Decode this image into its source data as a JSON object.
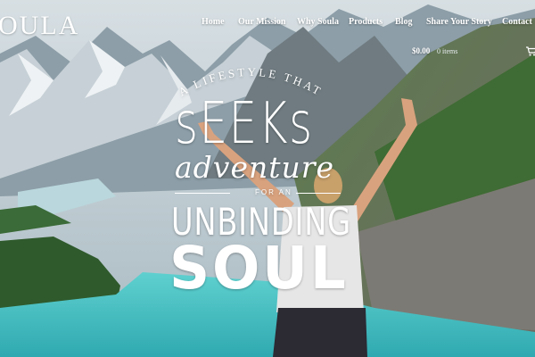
{
  "site": {
    "logo_text": "OULA"
  },
  "nav": {
    "items": [
      {
        "label": "Home"
      },
      {
        "label": "Our Mission"
      },
      {
        "label": "Why Soula"
      },
      {
        "label": "Products"
      },
      {
        "label": "Blog"
      },
      {
        "label": "Share Your Story"
      },
      {
        "label": "Contact"
      }
    ]
  },
  "cart": {
    "total": "$0.00",
    "items_label": "0 items",
    "icon": "cart-icon"
  },
  "hero": {
    "line1": "A LIFESTYLE THAT",
    "line2": "sEEKs",
    "line3": "adventure",
    "line4": "FOR AN",
    "line5": "UNBINDING",
    "line6": "SOUL"
  },
  "colors": {
    "text": "#ffffff",
    "lake": "#3fc0c4",
    "sky": "#c9d6dc",
    "forest": "#2f5a2c"
  }
}
